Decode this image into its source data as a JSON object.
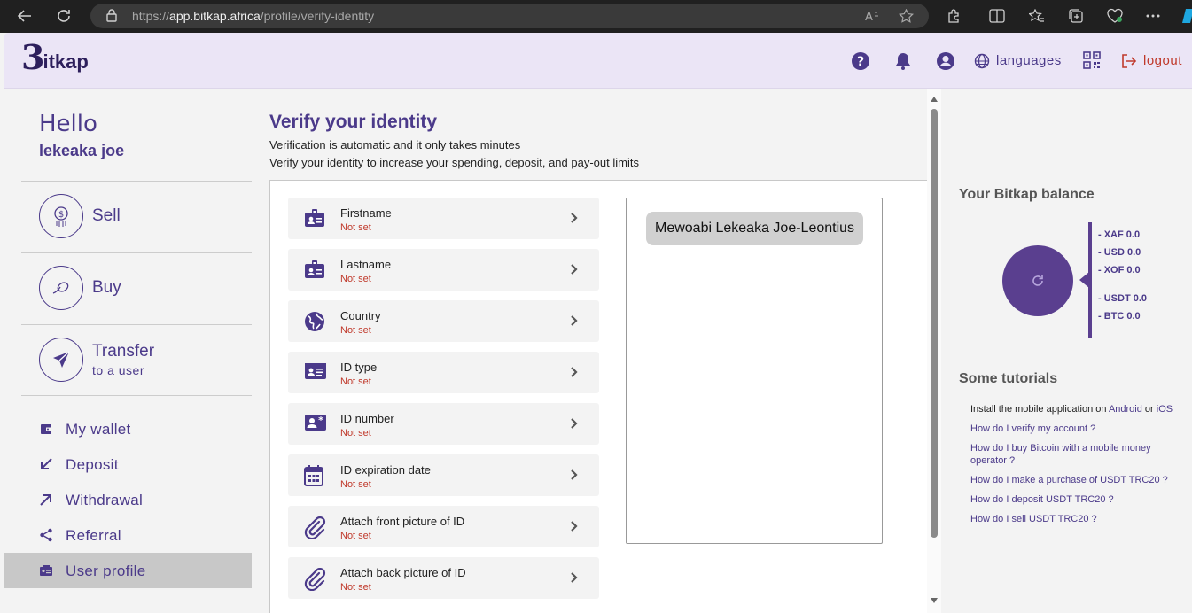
{
  "browser": {
    "url_scheme": "https://",
    "url_host": "app.bitkap.africa",
    "url_path": "/profile/verify-identity"
  },
  "header": {
    "logo_b": "3",
    "logo_text": "itkap",
    "languages_label": "languages",
    "logout_label": "logout"
  },
  "sidebar": {
    "hello": "Hello",
    "username": "lekeaka joe",
    "sell": "Sell",
    "buy": "Buy",
    "transfer": "Transfer",
    "transfer_sub": "to a user",
    "menu": [
      "My wallet",
      "Deposit",
      "Withdrawal",
      "Referral",
      "User profile"
    ]
  },
  "main": {
    "title": "Verify your identity",
    "desc1": "Verification is automatic and it only takes minutes",
    "desc2": "Verify your identity to increase your spending, deposit, and pay-out limits",
    "fields": [
      {
        "label": "Firstname",
        "status": "Not set",
        "icon": "id-badge-icon"
      },
      {
        "label": "Lastname",
        "status": "Not set",
        "icon": "id-badge-icon"
      },
      {
        "label": "Country",
        "status": "Not set",
        "icon": "globe-icon"
      },
      {
        "label": "ID type",
        "status": "Not set",
        "icon": "id-card-icon"
      },
      {
        "label": "ID number",
        "status": "Not set",
        "icon": "id-number-icon"
      },
      {
        "label": "ID expiration date",
        "status": "Not set",
        "icon": "calendar-icon"
      },
      {
        "label": "Attach front picture of ID",
        "status": "Not set",
        "icon": "paperclip-icon"
      },
      {
        "label": "Attach back picture of ID",
        "status": "Not set",
        "icon": "paperclip-icon"
      }
    ],
    "full_name": "Mewoabi Lekeaka Joe-Leontius"
  },
  "balance": {
    "title": "Your Bitkap balance",
    "lines": [
      "- XAF 0.0",
      "- USD 0.0",
      "- XOF 0.0",
      "- USDT 0.0",
      "- BTC 0.0"
    ]
  },
  "tutorials": {
    "title": "Some tutorials",
    "install_prefix": "Install the mobile application on ",
    "android": "Android",
    "or": " or ",
    "ios": "iOS",
    "items": [
      "How do I verify my account ?",
      "How do I buy Bitcoin with a mobile money operator ?",
      "How do I make a purchase of USDT TRC20 ?",
      "How do I deposit USDT TRC20 ?",
      "How do I sell USDT TRC20 ?"
    ]
  },
  "colors": {
    "brand": "#4b3a8a",
    "header_bg": "#ebe5f6",
    "logout": "#c0392b",
    "not_set": "#c0392b"
  }
}
